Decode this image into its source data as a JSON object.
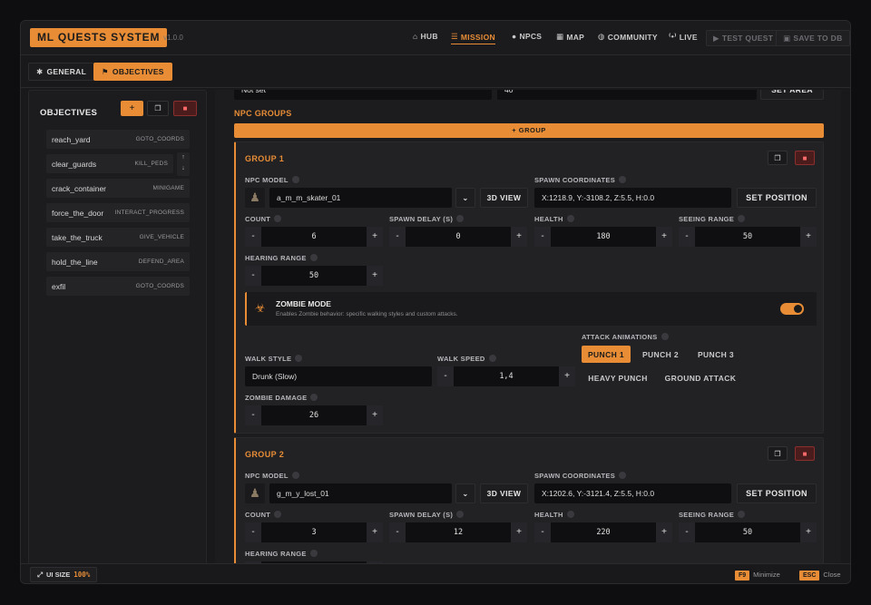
{
  "app": {
    "title": "ML QUESTS SYSTEM",
    "version": "v1.0.0"
  },
  "nav": {
    "hub": "HUB",
    "mission": "MISSION",
    "npcs": "NPCS",
    "map": "MAP",
    "community": "COMMUNITY",
    "live": "LIVE",
    "test": "TEST QUEST",
    "save": "SAVE TO DB"
  },
  "tabs": {
    "general": "GENERAL",
    "objectives": "OBJECTIVES"
  },
  "objectives": {
    "header": "OBJECTIVES",
    "items": [
      {
        "name": "reach_yard",
        "type": "GOTO_COORDS"
      },
      {
        "name": "clear_guards",
        "type": "KILL_PEDS"
      },
      {
        "name": "crack_container",
        "type": "MINIGAME"
      },
      {
        "name": "force_the_door",
        "type": "INTERACT_PROGRESS"
      },
      {
        "name": "take_the_truck",
        "type": "GIVE_VEHICLE"
      },
      {
        "name": "hold_the_line",
        "type": "DEFEND_AREA"
      },
      {
        "name": "exfil",
        "type": "GOTO_COORDS"
      }
    ]
  },
  "top_partial": {
    "left_value": "Not set",
    "right_value": "40",
    "button": "SET AREA"
  },
  "npc_groups": {
    "title": "NPC GROUPS",
    "add_group": "+ GROUP"
  },
  "labels": {
    "npc_model": "NPC MODEL",
    "spawn_coords": "SPAWN COORDINATES",
    "view3d": "3D VIEW",
    "set_position": "SET POSITION",
    "count": "COUNT",
    "spawn_delay": "SPAWN DELAY (S)",
    "health": "HEALTH",
    "seeing_range": "SEEING RANGE",
    "hearing_range": "HEARING RANGE",
    "minus": "-",
    "plus": "+"
  },
  "group1": {
    "title": "GROUP 1",
    "model": "a_m_m_skater_01",
    "coords": "X:1218.9, Y:-3108.2, Z:5.5, H:0.0",
    "count": "6",
    "spawn_delay": "0",
    "health": "180",
    "seeing_range": "50",
    "hearing_range": "50",
    "zombie": {
      "title": "ZOMBIE MODE",
      "desc": "Enables Zombie behavior: specific walking styles and custom attacks.",
      "enabled": true
    },
    "walk_style_label": "WALK STYLE",
    "walk_style": "Drunk (Slow)",
    "walk_speed_label": "WALK SPEED",
    "walk_speed": "1,4",
    "zombie_damage_label": "ZOMBIE DAMAGE",
    "zombie_damage": "26",
    "attack_label": "ATTACK ANIMATIONS",
    "attacks": [
      "PUNCH 1",
      "PUNCH 2",
      "PUNCH 3",
      "HEAVY PUNCH",
      "GROUND ATTACK"
    ],
    "attack_active": "PUNCH 1"
  },
  "group2": {
    "title": "GROUP 2",
    "model": "g_m_y_lost_01",
    "coords": "X:1202.6, Y:-3121.4, Z:5.5, H:0.0",
    "count": "3",
    "spawn_delay": "12",
    "health": "220",
    "seeing_range": "50"
  },
  "footer": {
    "ui_size_label": "UI SIZE",
    "ui_size": "100%",
    "min_key": "F9",
    "min_label": "Minimize",
    "close_key": "ESC",
    "close_label": "Close"
  },
  "colors": {
    "accent": "#e88d36",
    "danger": "#8a2e2e",
    "panel": "#222225"
  }
}
